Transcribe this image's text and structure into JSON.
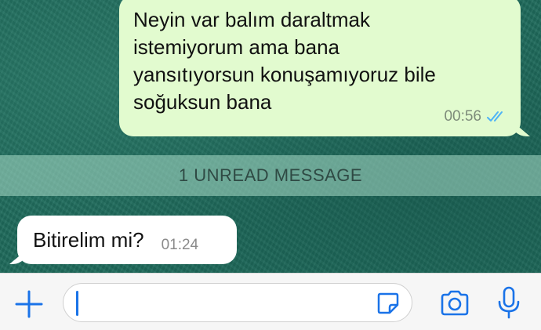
{
  "messages": {
    "outgoing": {
      "text": "Neyin var balım daraltmak\nistemiyorum ama bana\nyansıtıyorsun konuşamıyoruz bile\nsoğuksun bana",
      "time": "00:56",
      "status_icon": "double-check-read-icon"
    },
    "unread_divider": "1 UNREAD MESSAGE",
    "incoming": {
      "text": "Bitirelim mi?",
      "time": "01:24"
    }
  },
  "composer": {
    "placeholder": "",
    "attach_icon": "plus-icon",
    "sticker_icon": "sticker-icon",
    "camera_icon": "camera-icon",
    "mic_icon": "microphone-icon"
  },
  "colors": {
    "accent": "#1a73e8",
    "outgoing_bubble": "#e2fbcf",
    "incoming_bubble": "#ffffff",
    "chat_background": "#1f6b5c",
    "read_ticks": "#4fb3f6"
  }
}
